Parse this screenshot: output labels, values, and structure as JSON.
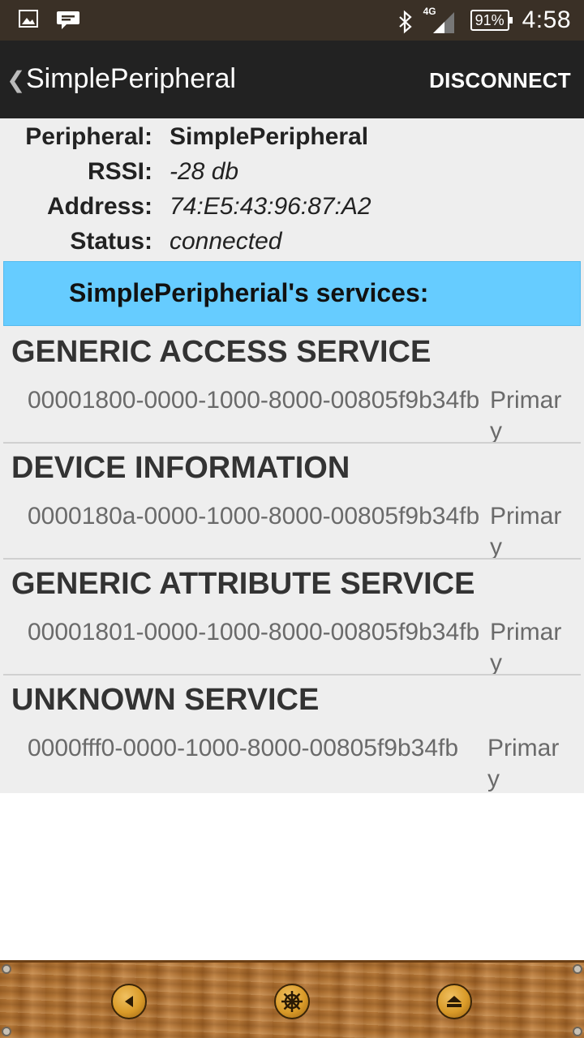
{
  "status_bar": {
    "network": "4G",
    "battery": "91%",
    "time": "4:58",
    "icons": [
      "image-icon",
      "chat-icon",
      "bluetooth-icon",
      "signal-icon",
      "battery-icon"
    ]
  },
  "action_bar": {
    "title": "SimplePeripheral",
    "disconnect_label": "DISCONNECT"
  },
  "info": [
    {
      "label": "Peripheral:",
      "value": "SimplePeripheral"
    },
    {
      "label": "RSSI:",
      "value": "-28 db"
    },
    {
      "label": "Address:",
      "value": "74:E5:43:96:87:A2"
    },
    {
      "label": "Status:",
      "value": "connected"
    }
  ],
  "services_header": "SimplePeripherial's services:",
  "services": [
    {
      "name": "GENERIC ACCESS SERVICE",
      "uuid": "00001800-0000-1000-8000-00805f9b34fb",
      "type": "Primary"
    },
    {
      "name": "DEVICE INFORMATION",
      "uuid": "0000180a-0000-1000-8000-00805f9b34fb",
      "type": "Primary"
    },
    {
      "name": "GENERIC ATTRIBUTE SERVICE",
      "uuid": "00001801-0000-1000-8000-00805f9b34fb",
      "type": "Primary"
    },
    {
      "name": "UNKNOWN SERVICE",
      "uuid": "0000fff0-0000-1000-8000-00805f9b34fb",
      "type": "Primary"
    }
  ],
  "colors": {
    "status_bar": "#3a3026",
    "action_bar": "#222222",
    "services_header": "#66ccff",
    "content_bg": "#eeeeee"
  },
  "toolbar_icons": [
    "back-icon",
    "helm-icon",
    "up-icon"
  ]
}
